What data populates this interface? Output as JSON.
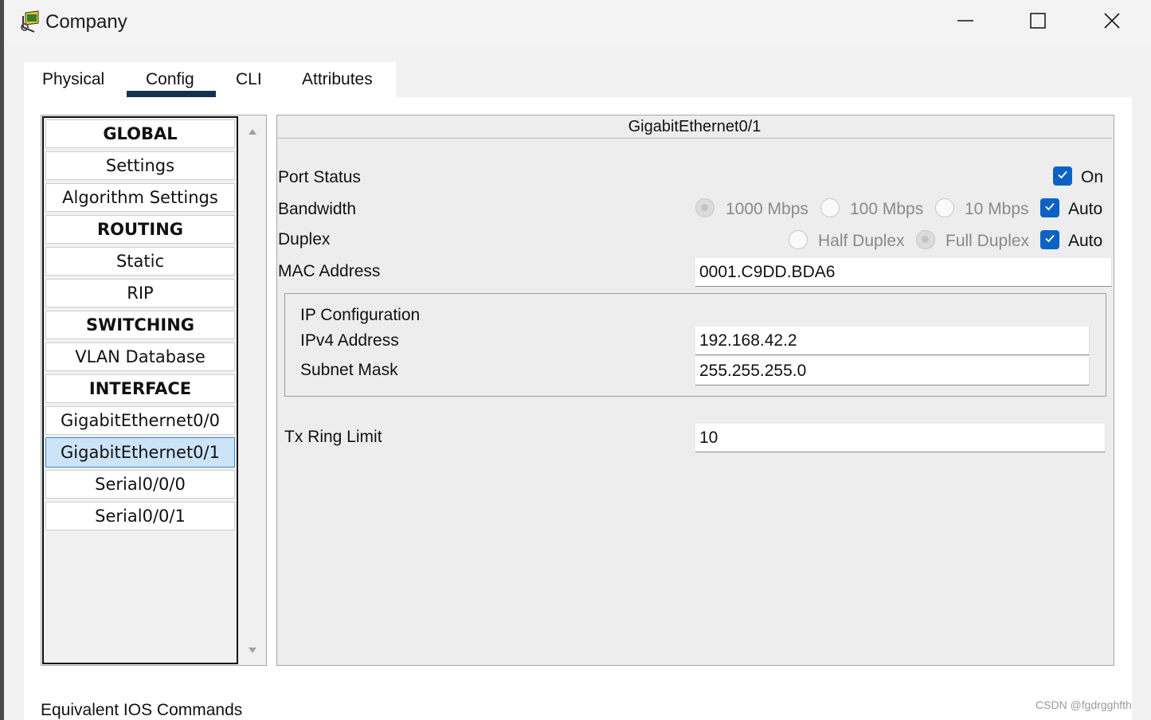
{
  "window": {
    "title": "Company",
    "minimize_label": "",
    "icons": {
      "app": "router-icon",
      "minimize": "minimize-icon",
      "maximize": "maximize-icon",
      "close": "close-icon"
    }
  },
  "tabs": [
    {
      "label": "Physical",
      "active": false
    },
    {
      "label": "Config",
      "active": true
    },
    {
      "label": "CLI",
      "active": false
    },
    {
      "label": "Attributes",
      "active": false
    }
  ],
  "sidebar": {
    "items": [
      {
        "label": "GLOBAL",
        "header": true
      },
      {
        "label": "Settings"
      },
      {
        "label": "Algorithm Settings"
      },
      {
        "label": "ROUTING",
        "header": true
      },
      {
        "label": "Static"
      },
      {
        "label": "RIP"
      },
      {
        "label": "SWITCHING",
        "header": true
      },
      {
        "label": "VLAN Database"
      },
      {
        "label": "INTERFACE",
        "header": true
      },
      {
        "label": "GigabitEthernet0/0"
      },
      {
        "label": "GigabitEthernet0/1",
        "selected": true
      },
      {
        "label": "Serial0/0/0"
      },
      {
        "label": "Serial0/0/1"
      }
    ]
  },
  "interface": {
    "title": "GigabitEthernet0/1",
    "port_status": {
      "label": "Port Status",
      "on_label": "On",
      "checked": true
    },
    "bandwidth": {
      "label": "Bandwidth",
      "options": [
        "1000 Mbps",
        "100 Mbps",
        "10 Mbps"
      ],
      "selected": "1000 Mbps",
      "auto_label": "Auto",
      "auto_checked": true
    },
    "duplex": {
      "label": "Duplex",
      "options": [
        "Half Duplex",
        "Full Duplex"
      ],
      "selected": "Full Duplex",
      "auto_label": "Auto",
      "auto_checked": true
    },
    "mac": {
      "label": "MAC Address",
      "value": "0001.C9DD.BDA6"
    },
    "ip_config": {
      "title": "IP Configuration",
      "ipv4_label": "IPv4 Address",
      "ipv4_value": "192.168.42.2",
      "mask_label": "Subnet Mask",
      "mask_value": "255.255.255.0"
    },
    "tx_ring": {
      "label": "Tx Ring Limit",
      "value": "10"
    }
  },
  "footer": {
    "equivalent_label": "Equivalent IOS Commands"
  },
  "watermark": "CSDN @fgdrgghfth",
  "colors": {
    "accent": "#0b62c4",
    "tab_underline": "#16324f",
    "selected_bg": "#cce4f7"
  }
}
